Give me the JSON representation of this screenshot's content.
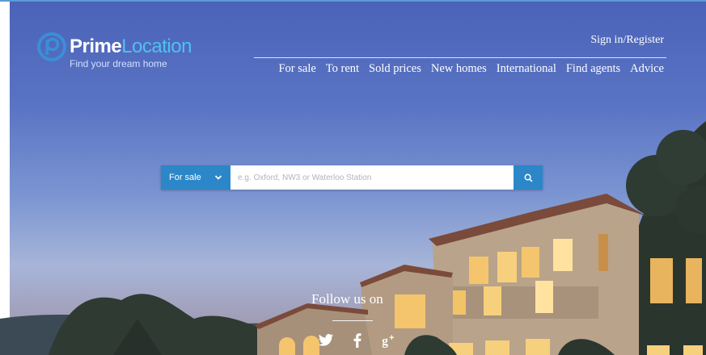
{
  "logo": {
    "name_part1": "Prime",
    "name_part2": "Location",
    "tagline": "Find your dream home",
    "mark_letter": "p"
  },
  "header": {
    "sign_in": "Sign in/Register",
    "nav": [
      "For sale",
      "To rent",
      "Sold prices",
      "New homes",
      "International",
      "Find agents",
      "Advice"
    ]
  },
  "search": {
    "type_selected": "For sale",
    "placeholder": "e.g. Oxford, NW3 or Waterloo Station",
    "value": ""
  },
  "follow": {
    "label": "Follow us on",
    "networks": [
      "twitter-icon",
      "facebook-icon",
      "google-plus-icon"
    ]
  },
  "colors": {
    "accent": "#2b87c8",
    "logo_accent": "#4fc0f0",
    "sky_top": "#4a62b8"
  }
}
